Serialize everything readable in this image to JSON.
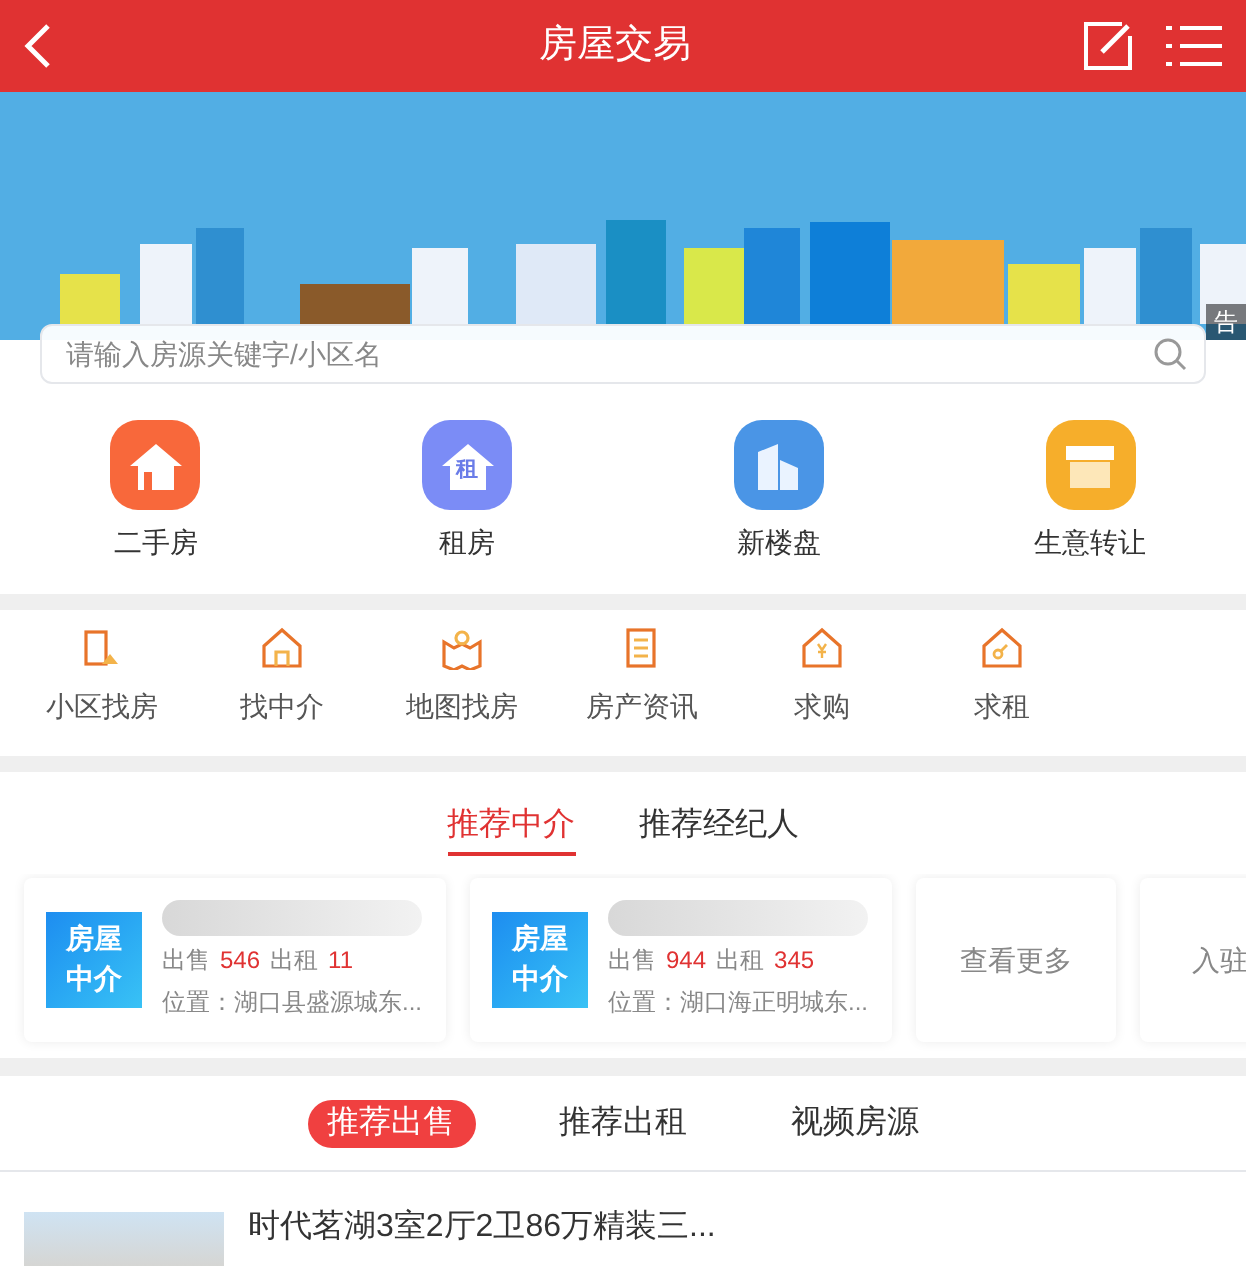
{
  "header": {
    "title": "房屋交易"
  },
  "banner": {
    "ad_badge": "告"
  },
  "search": {
    "placeholder": "请输入房源关键字/小区名"
  },
  "main_categories": [
    {
      "label": "二手房",
      "kind": "house"
    },
    {
      "label": "租房",
      "kind": "rent",
      "icon_text": "租"
    },
    {
      "label": "新楼盘",
      "kind": "building"
    },
    {
      "label": "生意转让",
      "kind": "shop"
    }
  ],
  "services": [
    {
      "label": "小区找房",
      "kind": "community"
    },
    {
      "label": "找中介",
      "kind": "agent"
    },
    {
      "label": "地图找房",
      "kind": "map"
    },
    {
      "label": "房产资讯",
      "kind": "news"
    },
    {
      "label": "求购",
      "kind": "buy"
    },
    {
      "label": "求租",
      "kind": "rentreq"
    }
  ],
  "agent_tabs": [
    {
      "label": "推荐中介",
      "selected": true
    },
    {
      "label": "推荐经纪人",
      "selected": false
    }
  ],
  "agencies": [
    {
      "kind": "agency",
      "logo": "房屋中介",
      "sale_label": "出售",
      "sale": "546",
      "rent_label": "出租",
      "rent": "11",
      "location": "位置：湖口县盛源城东..."
    },
    {
      "kind": "agency",
      "logo": "房屋中介",
      "sale_label": "出售",
      "sale": "944",
      "rent_label": "出租",
      "rent": "345",
      "location": "位置：湖口海正明城东..."
    },
    {
      "kind": "more",
      "label": "查看更多"
    },
    {
      "kind": "join",
      "label": "入驻"
    }
  ],
  "listing_tabs": [
    {
      "label": "推荐出售",
      "selected": true
    },
    {
      "label": "推荐出租",
      "selected": false
    },
    {
      "label": "视频房源",
      "selected": false
    }
  ],
  "listings": [
    {
      "title": "时代茗湖3室2厅2卫86万精装三..."
    }
  ]
}
